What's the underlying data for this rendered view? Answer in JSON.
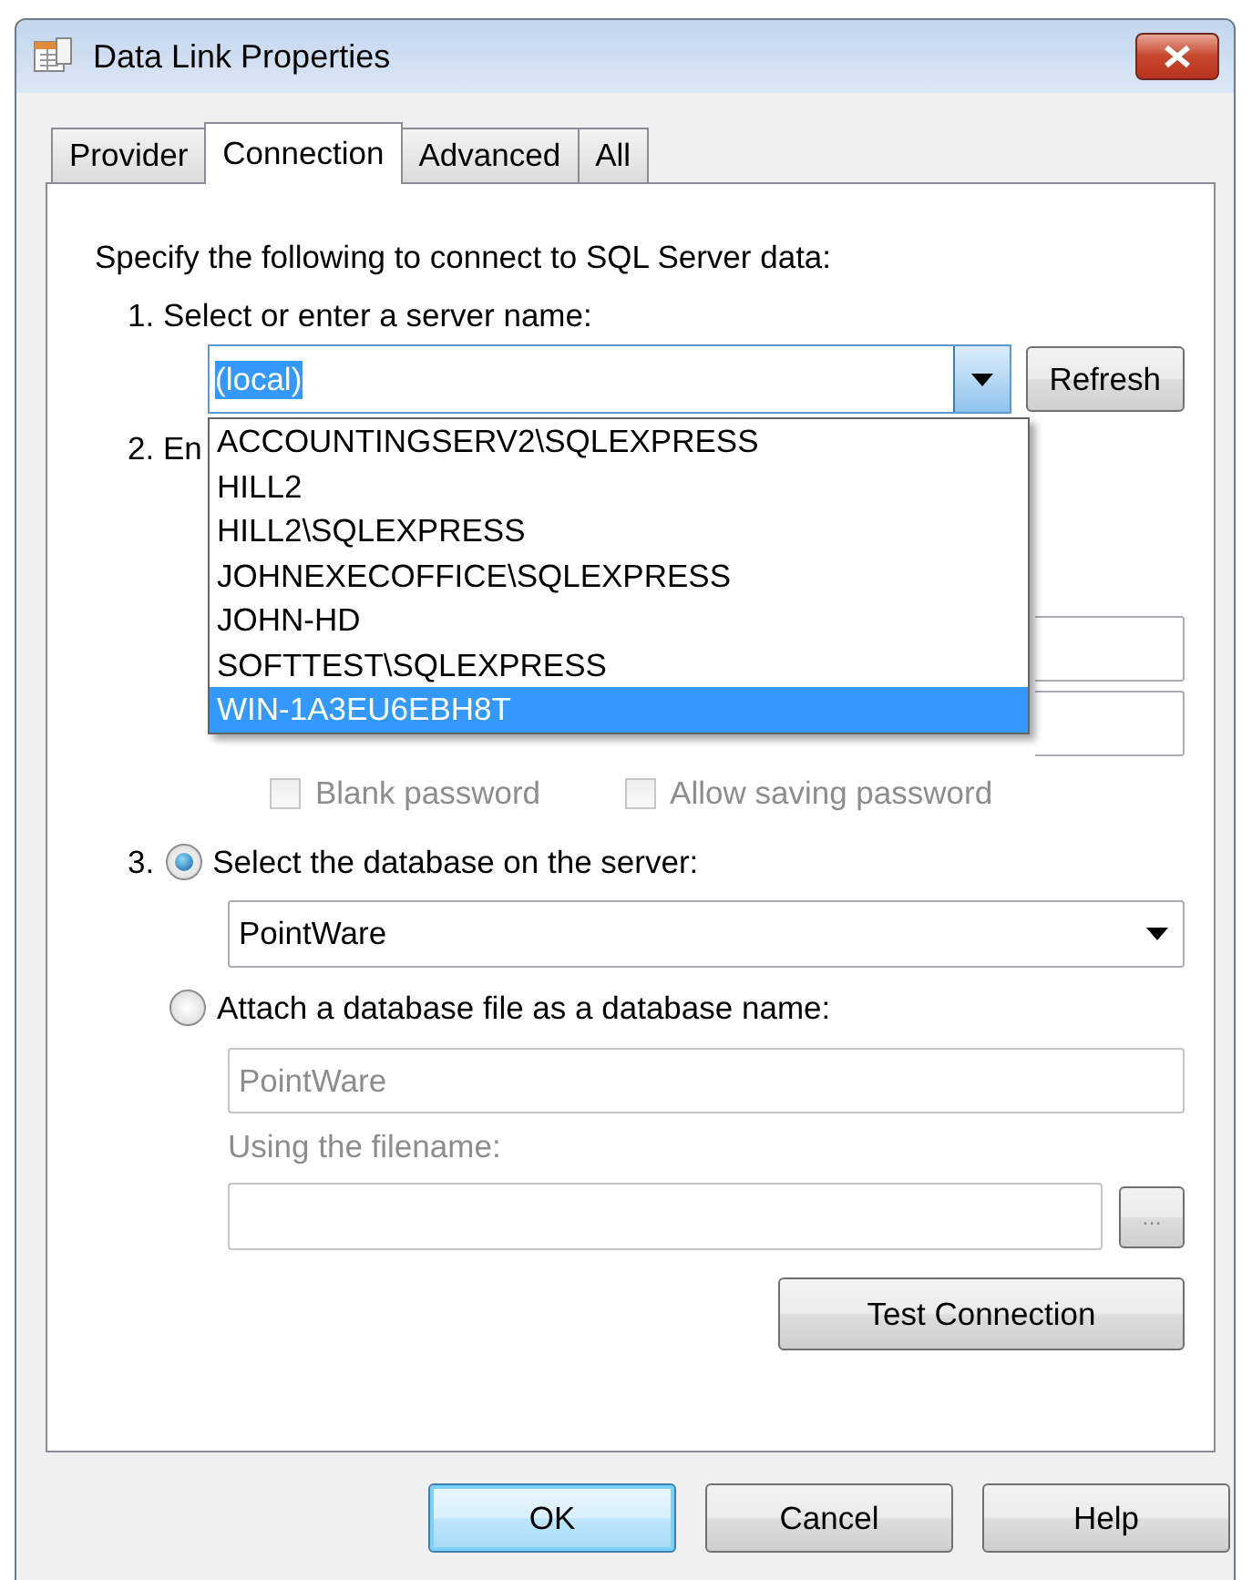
{
  "window": {
    "title": "Data Link Properties"
  },
  "tabs": [
    {
      "label": "Provider",
      "selected": false
    },
    {
      "label": "Connection",
      "selected": true
    },
    {
      "label": "Advanced",
      "selected": false
    },
    {
      "label": "All",
      "selected": false
    }
  ],
  "intro": "Specify the following to connect to SQL Server data:",
  "server": {
    "label": "1. Select or enter a server name:",
    "value": "(local)",
    "refresh_button": "Refresh",
    "expanded": true,
    "items": [
      {
        "label": "ACCOUNTINGSERV2\\SQLEXPRESS",
        "selected": false
      },
      {
        "label": "HILL2",
        "selected": false
      },
      {
        "label": "HILL2\\SQLEXPRESS",
        "selected": false
      },
      {
        "label": "JOHNEXECOFFICE\\SQLEXPRESS",
        "selected": false
      },
      {
        "label": "JOHN-HD",
        "selected": false
      },
      {
        "label": "SOFTTEST\\SQLEXPRESS",
        "selected": false
      },
      {
        "label": "WIN-1A3EU6EBH8T",
        "selected": true
      }
    ]
  },
  "login": {
    "label": "2. En",
    "checkboxes": [
      {
        "label": "Blank password",
        "checked": false,
        "disabled": true
      },
      {
        "label": "Allow saving password",
        "checked": false,
        "disabled": true
      }
    ]
  },
  "database": {
    "number": "3.",
    "options": [
      {
        "kind": "select",
        "label": "Select the database on the server:",
        "selected": true,
        "value": "PointWare"
      },
      {
        "kind": "attach",
        "label": "Attach a database file as a database name:",
        "selected": false,
        "value": "PointWare",
        "filename_label": "Using the filename:",
        "browse_button": "..."
      }
    ]
  },
  "test_button": "Test Connection",
  "buttons": [
    {
      "label": "OK",
      "default": true
    },
    {
      "label": "Cancel",
      "default": false
    },
    {
      "label": "Help",
      "default": false
    }
  ]
}
